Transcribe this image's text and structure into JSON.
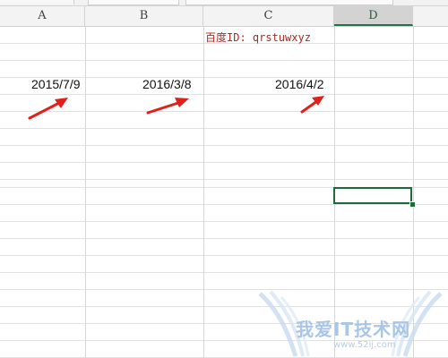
{
  "columns": {
    "a": "A",
    "b": "B",
    "c": "C",
    "d": "D",
    "selected": "D"
  },
  "cells": {
    "a_date": "2015/7/9",
    "b_date": "2016/3/8",
    "c_date": "2016/4/2",
    "c_note": "百度ID: qrstuwxyz"
  },
  "selection": {
    "active_column": "D"
  },
  "watermark": {
    "text": "我爱IT技术网",
    "url": "www.52ij.com"
  },
  "colors": {
    "arrow": "#e0201b",
    "note": "#b3261e",
    "selection": "#1e6b3a",
    "grid": "#e1e1e1",
    "header_bg": "#f3f3f3"
  },
  "icons": {
    "arrow": "red-arrow-icon",
    "watermark": "watermark-logo-icon"
  }
}
